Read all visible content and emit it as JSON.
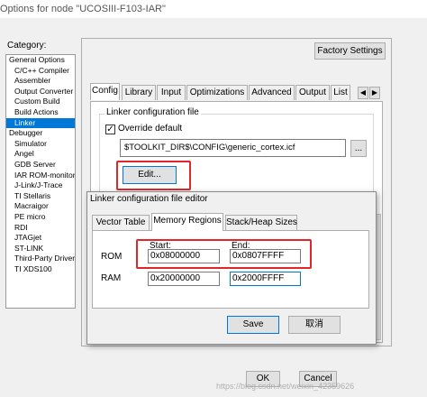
{
  "window": {
    "title": "Options for node \"UCOSIII-F103-IAR\""
  },
  "category": {
    "label": "Category:",
    "items": [
      {
        "label": "General Options",
        "sub": false
      },
      {
        "label": "C/C++ Compiler",
        "sub": true
      },
      {
        "label": "Assembler",
        "sub": true
      },
      {
        "label": "Output Converter",
        "sub": true
      },
      {
        "label": "Custom Build",
        "sub": true
      },
      {
        "label": "Build Actions",
        "sub": true
      },
      {
        "label": "Linker",
        "sub": true,
        "selected": true
      },
      {
        "label": "Debugger",
        "sub": false
      },
      {
        "label": "Simulator",
        "sub": true
      },
      {
        "label": "Angel",
        "sub": true
      },
      {
        "label": "GDB Server",
        "sub": true
      },
      {
        "label": "IAR ROM-monitor",
        "sub": true
      },
      {
        "label": "J-Link/J-Trace",
        "sub": true
      },
      {
        "label": "TI Stellaris",
        "sub": true
      },
      {
        "label": "Macraigor",
        "sub": true
      },
      {
        "label": "PE micro",
        "sub": true
      },
      {
        "label": "RDI",
        "sub": true
      },
      {
        "label": "JTAGjet",
        "sub": true
      },
      {
        "label": "ST-LINK",
        "sub": true
      },
      {
        "label": "Third-Party Driver",
        "sub": true
      },
      {
        "label": "TI XDS100",
        "sub": true
      }
    ]
  },
  "factory_settings": "Factory Settings",
  "tabs": [
    "Config",
    "Library",
    "Input",
    "Optimizations",
    "Advanced",
    "Output",
    "List"
  ],
  "tab_scroll": {
    "left": "◀",
    "right": "▶"
  },
  "config": {
    "group_label": "Linker configuration file",
    "override_label": "Override default",
    "override_checked": "✓",
    "path": "$TOOLKIT_DIR$\\CONFIG\\generic_cortex.icf",
    "browse_label": "...",
    "edit_label": "Edit..."
  },
  "dialog": {
    "title": "Linker configuration file editor",
    "tabs": [
      "Vector Table",
      "Memory Regions",
      "Stack/Heap Sizes"
    ],
    "start_label": "Start:",
    "end_label": "End:",
    "rom_label": "ROM",
    "ram_label": "RAM",
    "rom_start": "0x08000000",
    "rom_end": "0x0807FFFF",
    "ram_start": "0x20000000",
    "ram_end": "0x2000FFFF",
    "save_label": "Save",
    "cancel_label": "取消"
  },
  "footer": {
    "ok_label": "OK",
    "cancel_label": "Cancel",
    "watermark": "https://blog.csdn.net/weixin_42359626"
  },
  "colors": {
    "highlight": "#e0282a",
    "selection": "#0078d7"
  }
}
